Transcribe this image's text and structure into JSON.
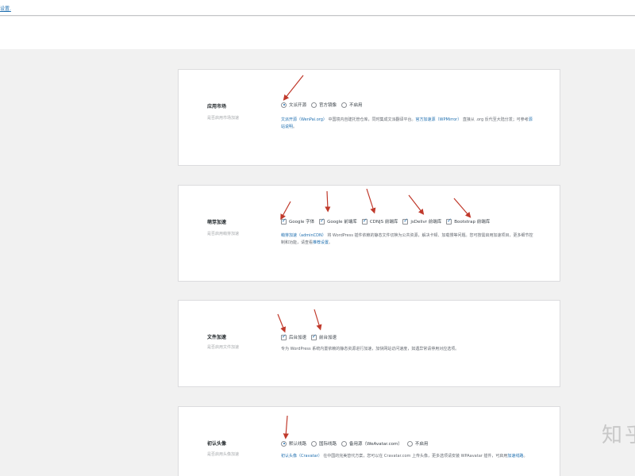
{
  "top_link": "设置.",
  "colors": {
    "accent": "#2271b1",
    "arrow": "#c0392b"
  },
  "sections": [
    {
      "title": "应用市场",
      "subtitle": "是否启用市场加速",
      "type": "radio",
      "options": [
        {
          "label": "文派开源",
          "checked": true
        },
        {
          "label": "官方镜像",
          "checked": false
        },
        {
          "label": "不启用",
          "checked": false
        }
      ],
      "desc_parts": [
        {
          "text": "文派开源（WenPai.org）",
          "link": true
        },
        {
          "text": " 中国境内自建托管仓库，同时集成文派翻译平台。",
          "link": false
        },
        {
          "text": "官方加速源（WPMirror）",
          "link": true
        },
        {
          "text": " 直接从 .org 反代至大陆分发；可参考",
          "link": false
        },
        {
          "text": "源站说明",
          "link": true
        },
        {
          "text": "。",
          "link": false
        }
      ]
    },
    {
      "title": "萌芽加速",
      "subtitle": "是否启用萌芽加速",
      "type": "checkbox",
      "options": [
        {
          "label": "Google 字体",
          "checked": true
        },
        {
          "label": "Google 前端库",
          "checked": true
        },
        {
          "label": "CDNJS 前端库",
          "checked": true
        },
        {
          "label": "jsDelivr 前端库",
          "checked": true
        },
        {
          "label": "Bootstrap 前端库",
          "checked": true
        }
      ],
      "desc_parts": [
        {
          "text": "萌芽加速（adminCDN）",
          "link": true
        },
        {
          "text": " 将 WordPress 插件依赖的静态文件切换为公共资源，解决卡顿、加载慢等问题。您可按需启用加速项目，更多细节控制和功能，请查看",
          "link": false
        },
        {
          "text": "推荐设置",
          "link": true
        },
        {
          "text": "。",
          "link": false
        }
      ]
    },
    {
      "title": "文件加速",
      "subtitle": "是否启用文件加速",
      "type": "checkbox",
      "options": [
        {
          "label": "后台加速",
          "checked": true
        },
        {
          "label": "前台加速",
          "checked": true
        }
      ],
      "desc_parts": [
        {
          "text": "专为 WordPress 系统内置依赖的静态资源进行加速，加快网站访问速度，如遇异常请停用对应选项。",
          "link": false
        }
      ]
    },
    {
      "title": "初认头像",
      "subtitle": "是否启用头像加速",
      "type": "radio",
      "options": [
        {
          "label": "默认线路",
          "checked": true
        },
        {
          "label": "国际线路",
          "checked": false
        },
        {
          "label": "备用源（WeAvatar.com）",
          "checked": false
        },
        {
          "label": "不启用",
          "checked": false
        }
      ],
      "desc_parts": [
        {
          "text": "初认头像（Cravatar）",
          "link": true
        },
        {
          "text": " 在中国的完美替代方案，您可以在 Cravatar.com 上传头像，更多选项请安装 WPAavatar 插件，可启用",
          "link": false
        },
        {
          "text": "加速线路",
          "link": true
        },
        {
          "text": "。",
          "link": false
        }
      ]
    }
  ],
  "watermark": "知乎"
}
